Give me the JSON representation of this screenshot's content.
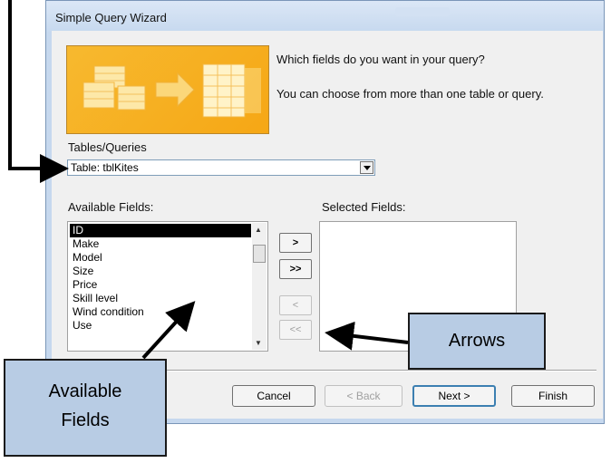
{
  "window": {
    "title": "Simple Query Wizard"
  },
  "prompt": {
    "question": "Which fields do you want in your query?",
    "hint": "You can choose from more than one table or query."
  },
  "tables_queries": {
    "label": "Tables/Queries",
    "value": "Table: tblKites"
  },
  "available": {
    "label": "Available Fields:",
    "items": [
      "ID",
      "Make",
      "Model",
      "Size",
      "Price",
      "Skill level",
      "Wind condition",
      "Use"
    ],
    "selected_item": "ID"
  },
  "selected_fields": {
    "label": "Selected Fields:",
    "items": []
  },
  "move_buttons": [
    {
      "label": ">",
      "enabled": true
    },
    {
      "label": ">>",
      "enabled": true
    },
    {
      "label": "<",
      "enabled": false
    },
    {
      "label": "<<",
      "enabled": false
    }
  ],
  "buttons": {
    "cancel": "Cancel",
    "back": "< Back",
    "next": "Next >",
    "finish": "Finish"
  },
  "annotations": {
    "arrows": "Arrows",
    "available_line1": "Available",
    "available_line2": "Fields"
  },
  "colors": {
    "illustration": "#f6a715",
    "callout_fill": "#b8cce4",
    "titlebar": "#c7d9ef"
  },
  "icons": [
    "dropdown-arrow-icon",
    "scroll-up-icon",
    "scroll-down-icon",
    "wizard-illustration"
  ]
}
